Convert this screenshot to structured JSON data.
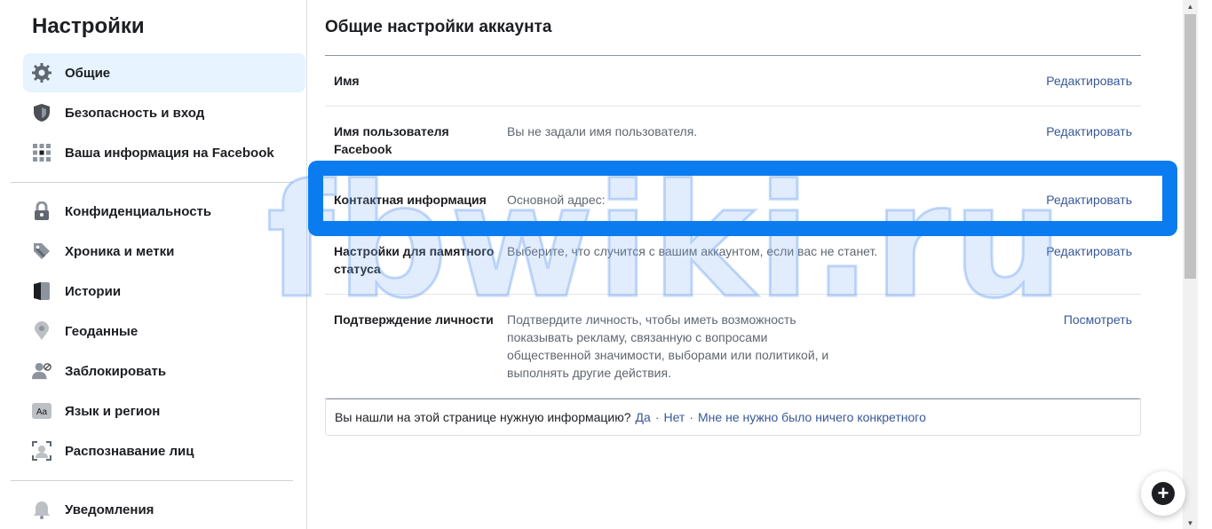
{
  "sidebar": {
    "title": "Настройки",
    "items": [
      {
        "label": "Общие",
        "icon": "gear-icon"
      },
      {
        "label": "Безопасность и вход",
        "icon": "shield-icon"
      },
      {
        "label": "Ваша информация на Facebook",
        "icon": "grid-icon"
      },
      {
        "label": "Конфиденциальность",
        "icon": "lock-icon"
      },
      {
        "label": "Хроника и метки",
        "icon": "tag-icon"
      },
      {
        "label": "Истории",
        "icon": "book-icon"
      },
      {
        "label": "Геоданные",
        "icon": "location-pin-icon"
      },
      {
        "label": "Заблокировать",
        "icon": "blocked-user-icon"
      },
      {
        "label": "Язык и регион",
        "icon": "language-icon"
      },
      {
        "label": "Распознавание лиц",
        "icon": "face-recognition-icon"
      },
      {
        "label": "Уведомления",
        "icon": "bell-icon"
      }
    ]
  },
  "main": {
    "title": "Общие настройки аккаунта",
    "rows": [
      {
        "label": "Имя",
        "value": "",
        "action": "Редактировать"
      },
      {
        "label": "Имя пользователя Facebook",
        "value": "Вы не задали имя пользователя.",
        "action": "Редактировать"
      },
      {
        "label": "Контактная информация",
        "value": "Основной адрес:",
        "action": "Редактировать"
      },
      {
        "label": "Настройки для памятного статуса",
        "value": "Выберите, что случится с вашим аккаунтом, если вас не станет.",
        "action": "Редактировать"
      },
      {
        "label": "Подтверждение личности",
        "value": "Подтвердите личность, чтобы иметь возможность показывать рекламу, связанную с вопросами общественной значимости, выборами или политикой, и выполнять другие действия.",
        "action": "Посмотреть"
      }
    ],
    "feedback": {
      "question": "Вы нашли на этой странице нужную информацию?",
      "yes": "Да",
      "no": "Нет",
      "other": "Мне не нужно было ничего конкретного",
      "separator": "·"
    }
  },
  "watermark": "fbwiki.ru",
  "colors": {
    "highlight": "#0a7cf0",
    "link": "#385898",
    "active_bg": "#e7f3ff"
  },
  "fab": {
    "icon": "plus-icon",
    "label": "+"
  }
}
